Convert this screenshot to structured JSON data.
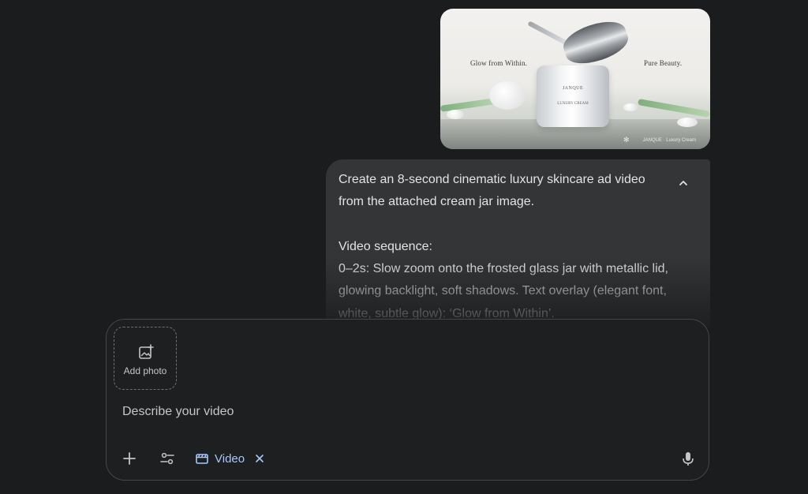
{
  "attachment": {
    "ad_left_text": "Glow from Within.",
    "ad_right_text": "Pure Beauty.",
    "jar_brand": "JANQUE",
    "jar_subtitle": "LUXURY CREAM",
    "watermark": "JANQUE · Luxury Cream"
  },
  "message": {
    "text": "Create an 8-second cinematic luxury skincare ad video from the attached cream jar image.\n\nVideo sequence:\n0–2s: Slow zoom onto the frosted glass jar with metallic lid, glowing backlight, soft shadows. Text overlay (elegant font, white, subtle glow): ‘Glow from Within’."
  },
  "composer": {
    "add_photo_label": "Add photo",
    "placeholder": "Describe your video",
    "value": "",
    "mode_chip_label": "Video"
  },
  "icons": {
    "collapse": "chevron-up-icon",
    "add_photo": "add-photo-icon",
    "plus": "plus-icon",
    "tools": "tune-icon",
    "video": "clapperboard-icon",
    "chip_close": "close-icon",
    "mic": "microphone-icon"
  },
  "colors": {
    "background": "#1b1c1d",
    "bubble": "#333537",
    "accent": "#a8c7fa",
    "text": "#e3e3e3"
  }
}
